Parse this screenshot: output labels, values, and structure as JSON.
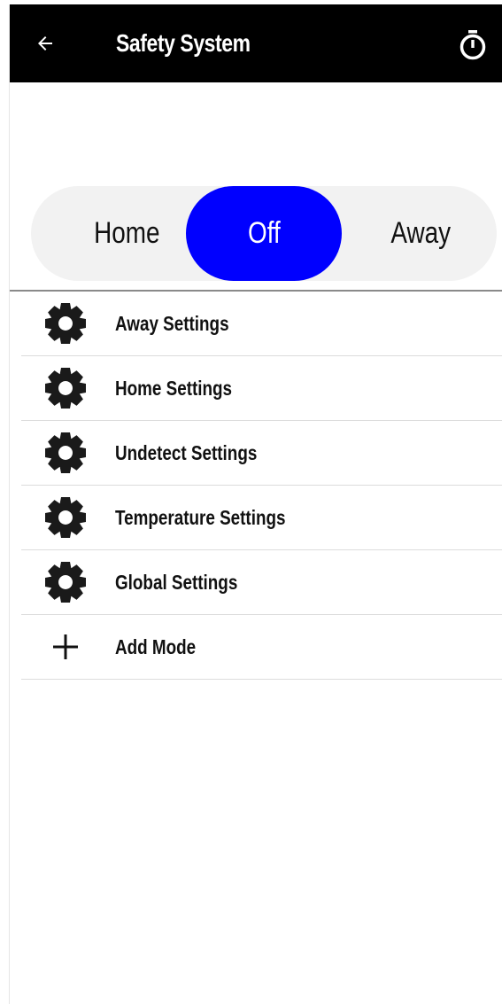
{
  "header": {
    "title": "Safety System",
    "back_icon": "arrow-left-icon",
    "timer_icon": "timer-icon",
    "background": "#000000"
  },
  "mode_selector": {
    "options": [
      "Home",
      "Off",
      "Away"
    ],
    "selected": "Off",
    "accent": "#0000ff"
  },
  "settings_list": {
    "items": [
      {
        "label": "Away Settings",
        "icon": "gear-icon"
      },
      {
        "label": "Home Settings",
        "icon": "gear-icon"
      },
      {
        "label": "Undetect Settings",
        "icon": "gear-icon"
      },
      {
        "label": "Temperature Settings",
        "icon": "gear-icon"
      },
      {
        "label": "Global Settings",
        "icon": "gear-icon"
      },
      {
        "label": "Add Mode",
        "icon": "plus-icon"
      }
    ]
  }
}
